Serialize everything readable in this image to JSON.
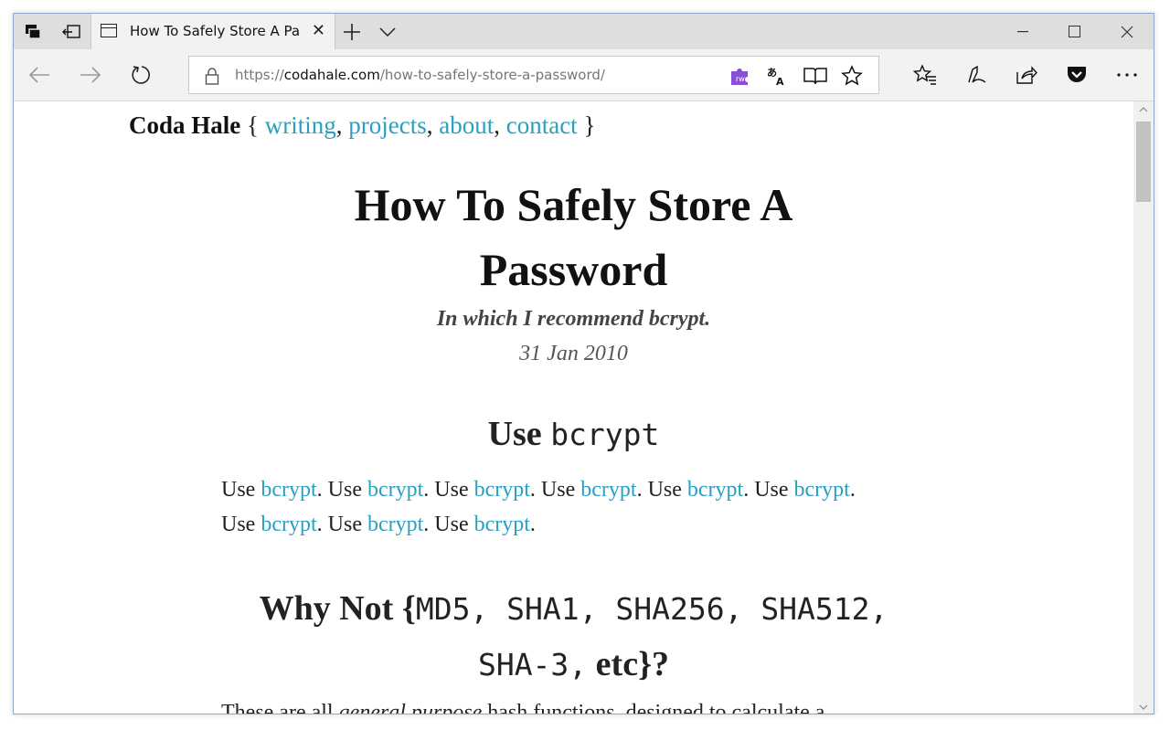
{
  "browser": {
    "tab_title": "How To Safely Store A Password",
    "url_scheme": "https://",
    "url_host": "codahale.com",
    "url_path": "/how-to-safely-store-a-password/",
    "addon_label": "rw",
    "accent_color": "#2aa0c0"
  },
  "site": {
    "brand": "Coda Hale",
    "open_brace": "{",
    "close_brace": "}",
    "nav": [
      "writing",
      "projects",
      "about",
      "contact"
    ]
  },
  "article": {
    "title_line1": "How To Safely Store A",
    "title_line2": "Password",
    "subtitle": "In which I recommend bcrypt.",
    "date": "31 Jan 2010",
    "section1": {
      "heading_text": "Use",
      "heading_code": "bcrypt"
    },
    "para1": {
      "word": "Use",
      "link": "bcrypt",
      "line1_count": 6,
      "line2_count": 3
    },
    "section2": {
      "line1_text": "Why Not ",
      "line1_brace": "{",
      "line1_code": "MD5, SHA1, SHA256, SHA512,",
      "line2_code": "SHA-3,",
      "line2_text": " etc",
      "line2_end": "}?"
    },
    "para2_fragment": "These are all general purpose hash functions, designed to calculate a"
  }
}
